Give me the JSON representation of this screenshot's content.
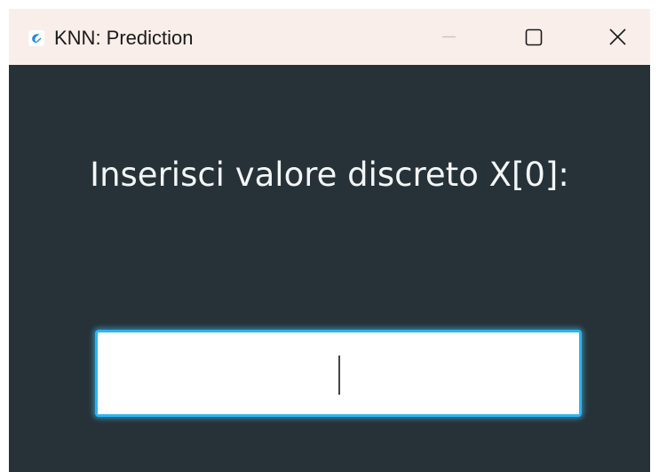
{
  "window": {
    "title": "KNN: Prediction",
    "app_icon": "feather-app-icon",
    "controls": {
      "minimize": "minimize-icon",
      "maximize": "maximize-icon",
      "close": "close-icon"
    }
  },
  "main": {
    "prompt": "Inserisci valore discreto X[0]:",
    "input": {
      "value": "",
      "placeholder": ""
    }
  },
  "colors": {
    "titlebar_bg": "#f9eeea",
    "content_bg": "#263238",
    "prompt_text": "#f4f6f7",
    "input_focus_border": "#29b6f6"
  }
}
